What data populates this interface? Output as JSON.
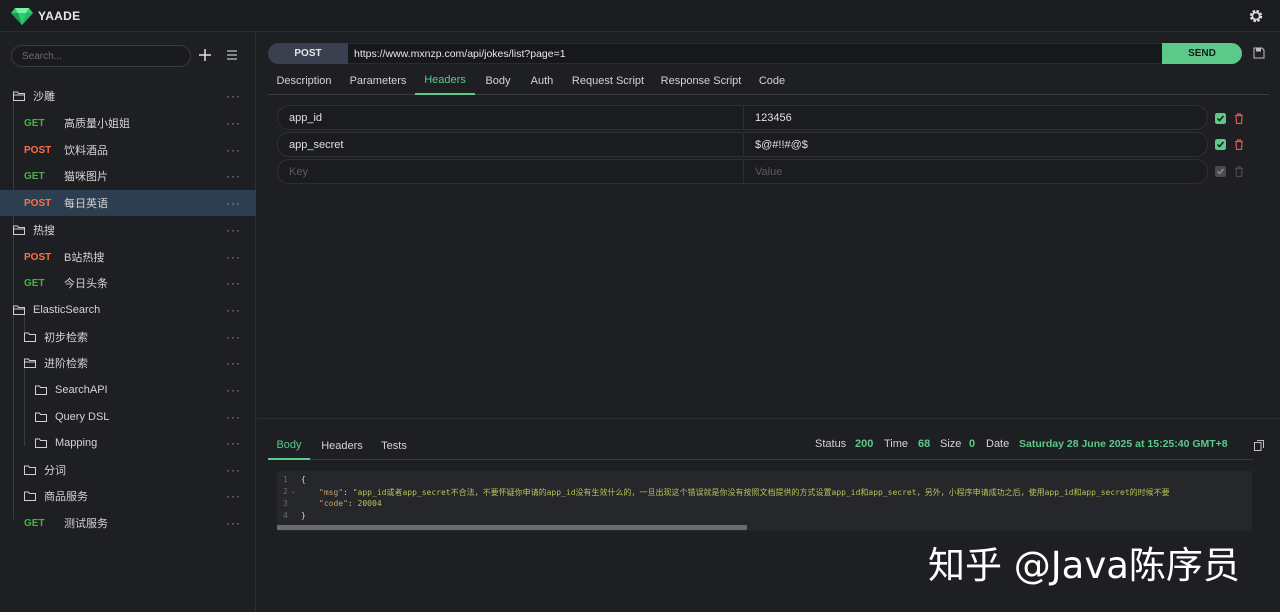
{
  "app": {
    "title": "YAADE"
  },
  "sidebar": {
    "search_placeholder": "Search...",
    "items": [
      {
        "type": "folder",
        "label": "沙雕"
      },
      {
        "type": "request",
        "method": "GET",
        "label": "高质量小姐姐"
      },
      {
        "type": "request",
        "method": "POST",
        "label": "饮料酒品"
      },
      {
        "type": "request",
        "method": "GET",
        "label": "猫咪图片"
      },
      {
        "type": "request",
        "method": "POST",
        "label": "每日英语",
        "selected": true
      },
      {
        "type": "folder",
        "label": "热搜"
      },
      {
        "type": "request",
        "method": "POST",
        "label": "B站热搜"
      },
      {
        "type": "request",
        "method": "GET",
        "label": "今日头条"
      },
      {
        "type": "folder",
        "label": "ElasticSearch"
      },
      {
        "type": "folder",
        "label": "初步检索"
      },
      {
        "type": "folder",
        "label": "进阶检索"
      },
      {
        "type": "folder",
        "label": "SearchAPI"
      },
      {
        "type": "folder",
        "label": "Query DSL"
      },
      {
        "type": "folder",
        "label": "Mapping"
      },
      {
        "type": "folder",
        "label": "分词"
      },
      {
        "type": "folder",
        "label": "商品服务"
      },
      {
        "type": "request",
        "method": "GET",
        "label": "测试服务"
      }
    ],
    "more_glyph": "···"
  },
  "request": {
    "method": "POST",
    "url": "https://www.mxnzp.com/api/jokes/list?page=1",
    "send_label": "SEND",
    "tabs": [
      "Description",
      "Parameters",
      "Headers",
      "Body",
      "Auth",
      "Request Script",
      "Response Script",
      "Code"
    ],
    "active_tab": "Headers",
    "headers": [
      {
        "key": "app_id",
        "value": "123456",
        "enabled": true
      },
      {
        "key": "app_secret",
        "value": "$@#!!#@$",
        "enabled": true
      }
    ],
    "key_placeholder": "Key",
    "value_placeholder": "Value"
  },
  "response": {
    "tabs": [
      "Body",
      "Headers",
      "Tests"
    ],
    "active_tab": "Body",
    "status_label": "Status",
    "status": "200",
    "time_label": "Time",
    "time": "68",
    "size_label": "Size",
    "size": "0",
    "date_label": "Date",
    "date": "Saturday 28 June 2025 at 15:25:40 GMT+8",
    "line_numbers": [
      "1",
      "2",
      "3",
      "4"
    ],
    "body": {
      "open": "{",
      "msg_key": "\"msg\"",
      "msg_value": "\"app_id或者app_secret不合法，不要怀疑你申请的app_id没有生效什么的，一旦出现这个错误就是你没有按照文档提供的方式设置app_id和app_secret，另外，小程序申请成功之后，使用app_id和app_secret的时候不要",
      "code_key": "\"code\"",
      "code_value": "20004",
      "close": "}"
    }
  },
  "watermark": "知乎 @Java陈序员",
  "colors": {
    "get": "#4caf50",
    "post": "#ff7043",
    "accent": "#5cc98a",
    "selected_row": "#2c3e50"
  }
}
